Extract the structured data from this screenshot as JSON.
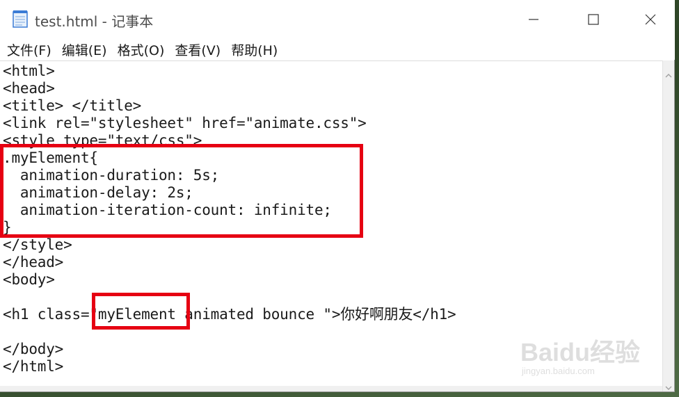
{
  "window": {
    "title": "test.html - 记事本",
    "app_icon": "notepad-icon",
    "controls": {
      "minimize_icon": "minimize-icon",
      "maximize_icon": "maximize-icon",
      "close_icon": "close-icon"
    }
  },
  "menu": {
    "items": [
      {
        "label": "文件(F)"
      },
      {
        "label": "编辑(E)"
      },
      {
        "label": "格式(O)"
      },
      {
        "label": "查看(V)"
      },
      {
        "label": "帮助(H)"
      }
    ]
  },
  "editor": {
    "lines": [
      "<html>",
      "<head>",
      "<title> </title>",
      "<link rel=\"stylesheet\" href=\"animate.css\">",
      "<style type=\"text/css\">",
      ".myElement{",
      "  animation-duration: 5s;",
      "  animation-delay: 2s;",
      "  animation-iteration-count: infinite;",
      "}",
      "</style>",
      "</head>",
      "<body>",
      "",
      "<h1 class=\"myElement animated bounce \">你好啊朋友</h1>",
      "",
      "</body>",
      "</html>"
    ]
  },
  "watermark": {
    "logo": "Baidu经验",
    "sub": "jingyan.baidu.com"
  },
  "colors": {
    "highlight": "#e60012",
    "text": "#1a1a1a",
    "title": "#4d4d4d"
  }
}
